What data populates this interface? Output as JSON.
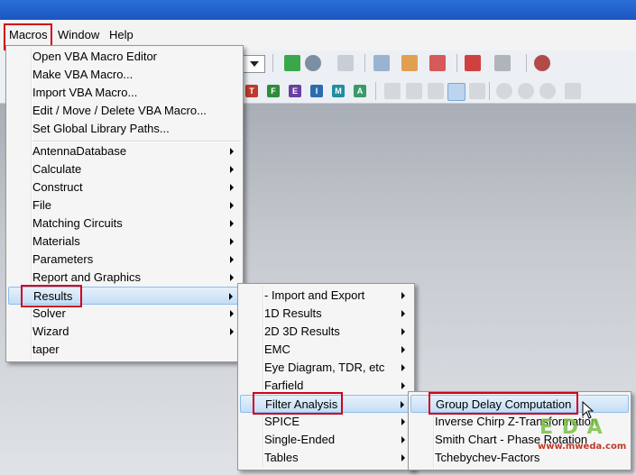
{
  "menubar": {
    "macros": {
      "label": "Macros"
    },
    "window": {
      "label": "Window"
    },
    "help": {
      "label": "Help"
    }
  },
  "macros_menu": {
    "group1": [
      "Open VBA Macro Editor",
      "Make VBA Macro...",
      "Import VBA Macro...",
      "Edit / Move / Delete VBA Macro...",
      "Set Global Library Paths..."
    ],
    "group2": [
      "AntennaDatabase",
      "Calculate",
      "Construct",
      "File",
      "Matching Circuits",
      "Materials",
      "Parameters",
      "Report and Graphics",
      "Results",
      "Solver",
      "Wizard",
      "taper"
    ]
  },
  "results_menu": {
    "items": [
      "- Import and Export",
      "1D Results",
      "2D 3D Results",
      "EMC",
      "Eye Diagram, TDR, etc",
      "Farfield",
      "Filter Analysis",
      "SPICE",
      "Single-Ended",
      "Tables"
    ]
  },
  "filter_menu": {
    "items": [
      "Group Delay Computation",
      "Inverse Chirp Z-Transformation",
      "Smith Chart - Phase Rotation",
      "Tchebychev-Factors"
    ]
  },
  "toolbar_letters": [
    "T",
    "F",
    "E",
    "I",
    "M",
    "A"
  ],
  "watermark": {
    "logo": "E D A",
    "url": "www.mweda.com"
  },
  "colors": {
    "highlight_border": "#d0021b",
    "menu_hover": "#c4def6",
    "titlebar": "#1b55c0"
  }
}
